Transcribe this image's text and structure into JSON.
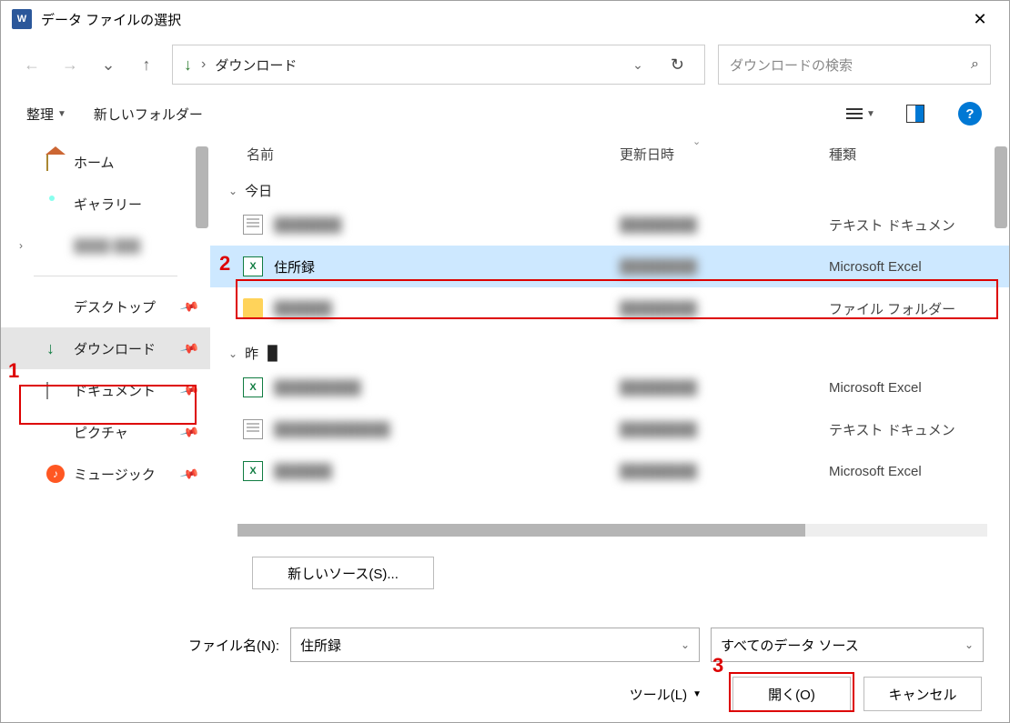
{
  "titlebar": {
    "title": "データ ファイルの選択"
  },
  "address": {
    "location": "ダウンロード"
  },
  "search": {
    "placeholder": "ダウンロードの検索"
  },
  "toolbar": {
    "organize": "整理",
    "newfolder": "新しいフォルダー"
  },
  "columns": {
    "name": "名前",
    "date": "更新日時",
    "type": "種類"
  },
  "sidebar": {
    "home": "ホーム",
    "gallery": "ギャラリー",
    "onedrive": "",
    "desktop": "デスクトップ",
    "downloads": "ダウンロード",
    "documents": "ドキュメント",
    "pictures": "ピクチャ",
    "music": "ミュージック"
  },
  "groups": {
    "today": "今日",
    "yesterday": "昨"
  },
  "filetypes": {
    "txt": "テキスト ドキュメン",
    "xlsx": "Microsoft Excel ",
    "folder": "ファイル フォルダー"
  },
  "files": {
    "selected": "住所録"
  },
  "bottom": {
    "newsource": "新しいソース(S)...",
    "filename_label": "ファイル名(N):",
    "filename_value": "住所録",
    "filter": "すべてのデータ ソース",
    "tools": "ツール(L)",
    "open": "開く(O)",
    "cancel": "キャンセル"
  },
  "annotations": {
    "a1": "1",
    "a2": "2",
    "a3": "3"
  }
}
